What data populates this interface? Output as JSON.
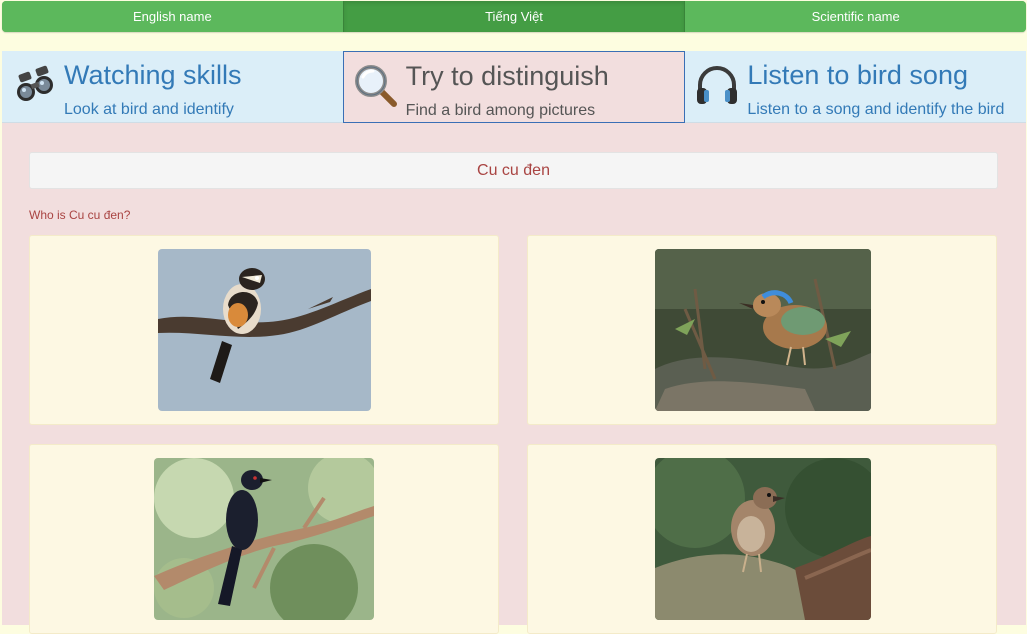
{
  "language_bar": {
    "english": "English name",
    "vietnamese": "Tiếng Việt",
    "scientific": "Scientific name"
  },
  "modes": [
    {
      "title": "Watching skills",
      "subtitle": "Look at bird and identify",
      "icon": "binoculars-icon"
    },
    {
      "title": "Try to distinguish",
      "subtitle": "Find a bird among pictures",
      "icon": "magnifier-icon"
    },
    {
      "title": "Listen to bird song",
      "subtitle": "Listen to a song and identify the bird",
      "icon": "headphones-icon"
    }
  ],
  "quiz": {
    "bird_name": "Cu cu đen",
    "question": "Who is Cu cu đen?",
    "options": [
      {
        "photo": "bird-on-branch-sky"
      },
      {
        "photo": "pitta-on-rocks"
      },
      {
        "photo": "black-drongo-on-branch"
      },
      {
        "photo": "brown-bird-on-rock"
      }
    ]
  },
  "colors": {
    "language_bar": "#5cb85c",
    "language_active": "#449d44",
    "mode_background": "#dbeef8",
    "mode_active": "#f2dede",
    "link_blue": "#337ab7",
    "question_red": "#a94442",
    "card_background": "#fdf8e3"
  }
}
